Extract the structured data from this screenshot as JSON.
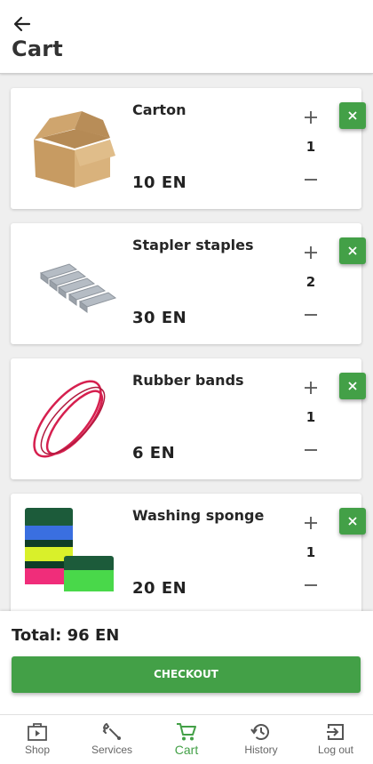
{
  "header": {
    "back_icon": "arrow-left-icon",
    "title": "Cart"
  },
  "colors": {
    "accent": "#43a047",
    "background": "#efefef"
  },
  "cart": {
    "items": [
      {
        "name": "Carton",
        "price": "10 EN",
        "quantity": "1",
        "image": "cardboard-box-image"
      },
      {
        "name": "Stapler staples",
        "price": "30 EN",
        "quantity": "2",
        "image": "staples-image"
      },
      {
        "name": "Rubber bands",
        "price": "6 EN",
        "quantity": "1",
        "image": "rubber-bands-image"
      },
      {
        "name": "Washing sponge",
        "price": "20 EN",
        "quantity": "1",
        "image": "sponges-image"
      }
    ]
  },
  "summary": {
    "total": "Total: 96 EN",
    "checkout_label": "CHECKOUT"
  },
  "nav": {
    "items": [
      {
        "label": "Shop",
        "icon": "shop-icon"
      },
      {
        "label": "Services",
        "icon": "wrench-icon"
      },
      {
        "label": "Cart",
        "icon": "cart-icon",
        "active": true
      },
      {
        "label": "History",
        "icon": "history-icon"
      },
      {
        "label": "Log out",
        "icon": "logout-icon"
      }
    ]
  }
}
